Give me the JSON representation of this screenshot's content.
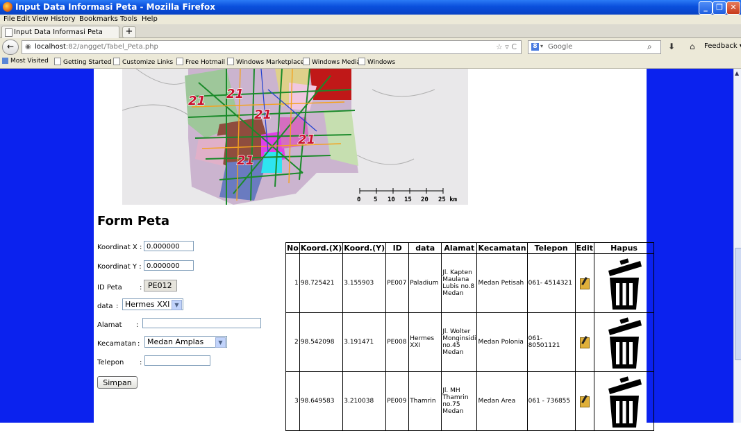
{
  "window": {
    "title": "Input Data Informasi Peta - Mozilla Firefox",
    "min": "_",
    "max": "❐",
    "close": "✕"
  },
  "menu": [
    "File",
    "Edit",
    "View",
    "History",
    "Bookmarks",
    "Tools",
    "Help"
  ],
  "tab": {
    "label": "Input Data Informasi Peta",
    "new_tab": "+"
  },
  "nav": {
    "back": "←",
    "url_host": "localhost",
    "url_rest": ":82/angget/Tabel_Peta.php",
    "url_icons": "☆ ▿ C",
    "search_placeholder": "Google",
    "search_engine": "8",
    "feedback": "Feedback"
  },
  "bookmarks": [
    "Most Visited",
    "Getting Started",
    "Customize Links",
    "Free Hotmail",
    "Windows Marketplace",
    "Windows Media",
    "Windows"
  ],
  "map": {
    "badge": "21",
    "scale_labels": [
      "0",
      "5",
      "10",
      "15",
      "20",
      "25 km"
    ]
  },
  "form": {
    "title": "Form Peta",
    "x_label": "Koordinat X :",
    "x_value": "0.000000",
    "y_label": "Koordinat Y :",
    "y_value": "0.000000",
    "id_label": "ID Peta",
    "id_colon": ":",
    "id_value": "PE012",
    "data_label": "data",
    "data_colon": ":",
    "data_value": "Hermes XXI",
    "alamat_label": "Alamat",
    "alamat_colon": ":",
    "alamat_value": "",
    "kecamatan_label": "Kecamatan",
    "kecamatan_colon": ":",
    "kecamatan_value": "Medan Amplas",
    "telepon_label": "Telepon",
    "telepon_colon": ":",
    "telepon_value": "",
    "submit": "Simpan"
  },
  "table": {
    "headers": [
      "No",
      "Koord.(X)",
      "Koord.(Y)",
      "ID",
      "data",
      "Alamat",
      "Kecamatan",
      "Telepon",
      "Edit",
      "Hapus"
    ],
    "rows": [
      {
        "no": "1",
        "x": "98.725421",
        "y": "3.155903",
        "id": "PE007",
        "data": "Paladium",
        "alamat": "Jl. Kapten Maulana Lubis no.8 Medan",
        "kecamatan": "Medan Petisah",
        "telepon": "061- 4514321"
      },
      {
        "no": "2",
        "x": "98.542098",
        "y": "3.191471",
        "id": "PE008",
        "data": "Hermes XXI",
        "alamat": "Jl. Wolter Monginsidi no.45 Medan",
        "kecamatan": "Medan Polonia",
        "telepon": "061-80501121"
      },
      {
        "no": "3",
        "x": "98.649583",
        "y": "3.210038",
        "id": "PE009",
        "data": "Thamrin",
        "alamat": "Jl. MH Thamrin no.75 Medan",
        "kecamatan": "Medan Area",
        "telepon": "061 - 736855"
      }
    ]
  }
}
